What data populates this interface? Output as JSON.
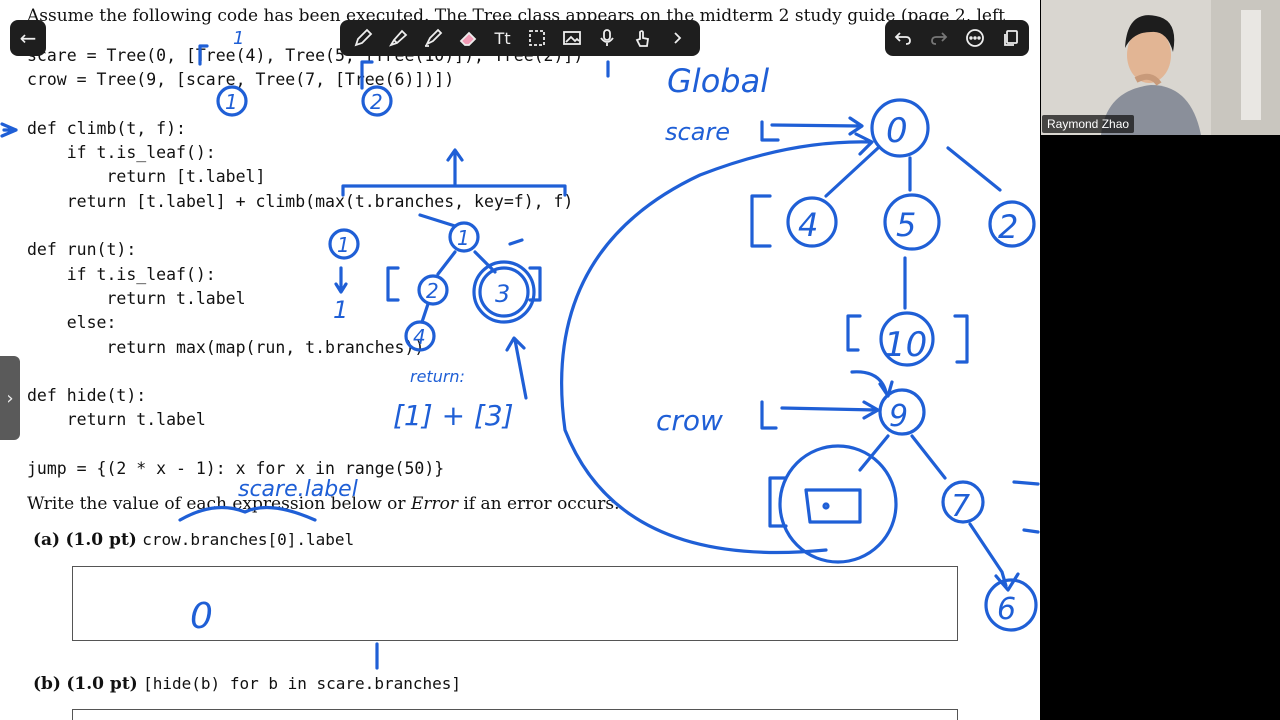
{
  "document": {
    "intro": "Assume the following code has been executed. The Tree class appears on the midterm 2 study guide (page 2, left",
    "code_lines": [
      "scare = Tree(0, [Tree(4), Tree(5, [Tree(10)]), Tree(2)])",
      "crow = Tree(9, [scare, Tree(7, [Tree(6)])])",
      "",
      "def climb(t, f):",
      "    if t.is_leaf():",
      "        return [t.label]",
      "    return [t.label] + climb(max(t.branches, key=f), f)",
      "",
      "def run(t):",
      "    if t.is_leaf():",
      "        return t.label",
      "    else:",
      "        return max(map(run, t.branches))",
      "",
      "def hide(t):",
      "    return t.label",
      "",
      "jump = {(2 * x - 1): x for x in range(50)}"
    ],
    "prompt_pre": "Write the value of each expression below or ",
    "prompt_em": "Error",
    "prompt_post": " if an error occurs.",
    "questions": [
      {
        "letter": "(a)",
        "points": "(1.0 pt)",
        "expr": "crow.branches[0].label"
      },
      {
        "letter": "(b)",
        "points": "(1.0 pt)",
        "expr": "[hide(b) for b in scare.branches]"
      }
    ]
  },
  "annotations": {
    "global_label": "Global",
    "scare_label": "scare",
    "crow_label": "crow",
    "scare_dot_label": "scare.label",
    "return_label": "return:",
    "return_expr": "[1] + [3]",
    "answer_a": "0",
    "nodes": {
      "n0": "0",
      "n4": "4",
      "n5": "5",
      "n2": "2",
      "n10": "10",
      "n9": "9",
      "n7": "7",
      "n6": "6"
    },
    "mini_tree": {
      "root": "1",
      "left": "2",
      "right": "3",
      "leaf": "4",
      "side": "1",
      "side_value": "1"
    },
    "code_marks": {
      "one": "1",
      "two": "2"
    }
  },
  "participant": {
    "name": "Raymond Zhao"
  },
  "toolbar": {
    "tools": [
      "pen-icon",
      "highlighter-icon",
      "marker-icon",
      "eraser-icon",
      "text-tool-icon",
      "lasso-icon",
      "image-icon",
      "microphone-icon",
      "touch-icon",
      "chevron-right-icon"
    ],
    "right_tools": [
      "undo-icon",
      "redo-icon",
      "more-icon",
      "pages-icon"
    ]
  },
  "colors": {
    "ink": "#1f5fd6",
    "toolbar": "#1e1e1e"
  }
}
